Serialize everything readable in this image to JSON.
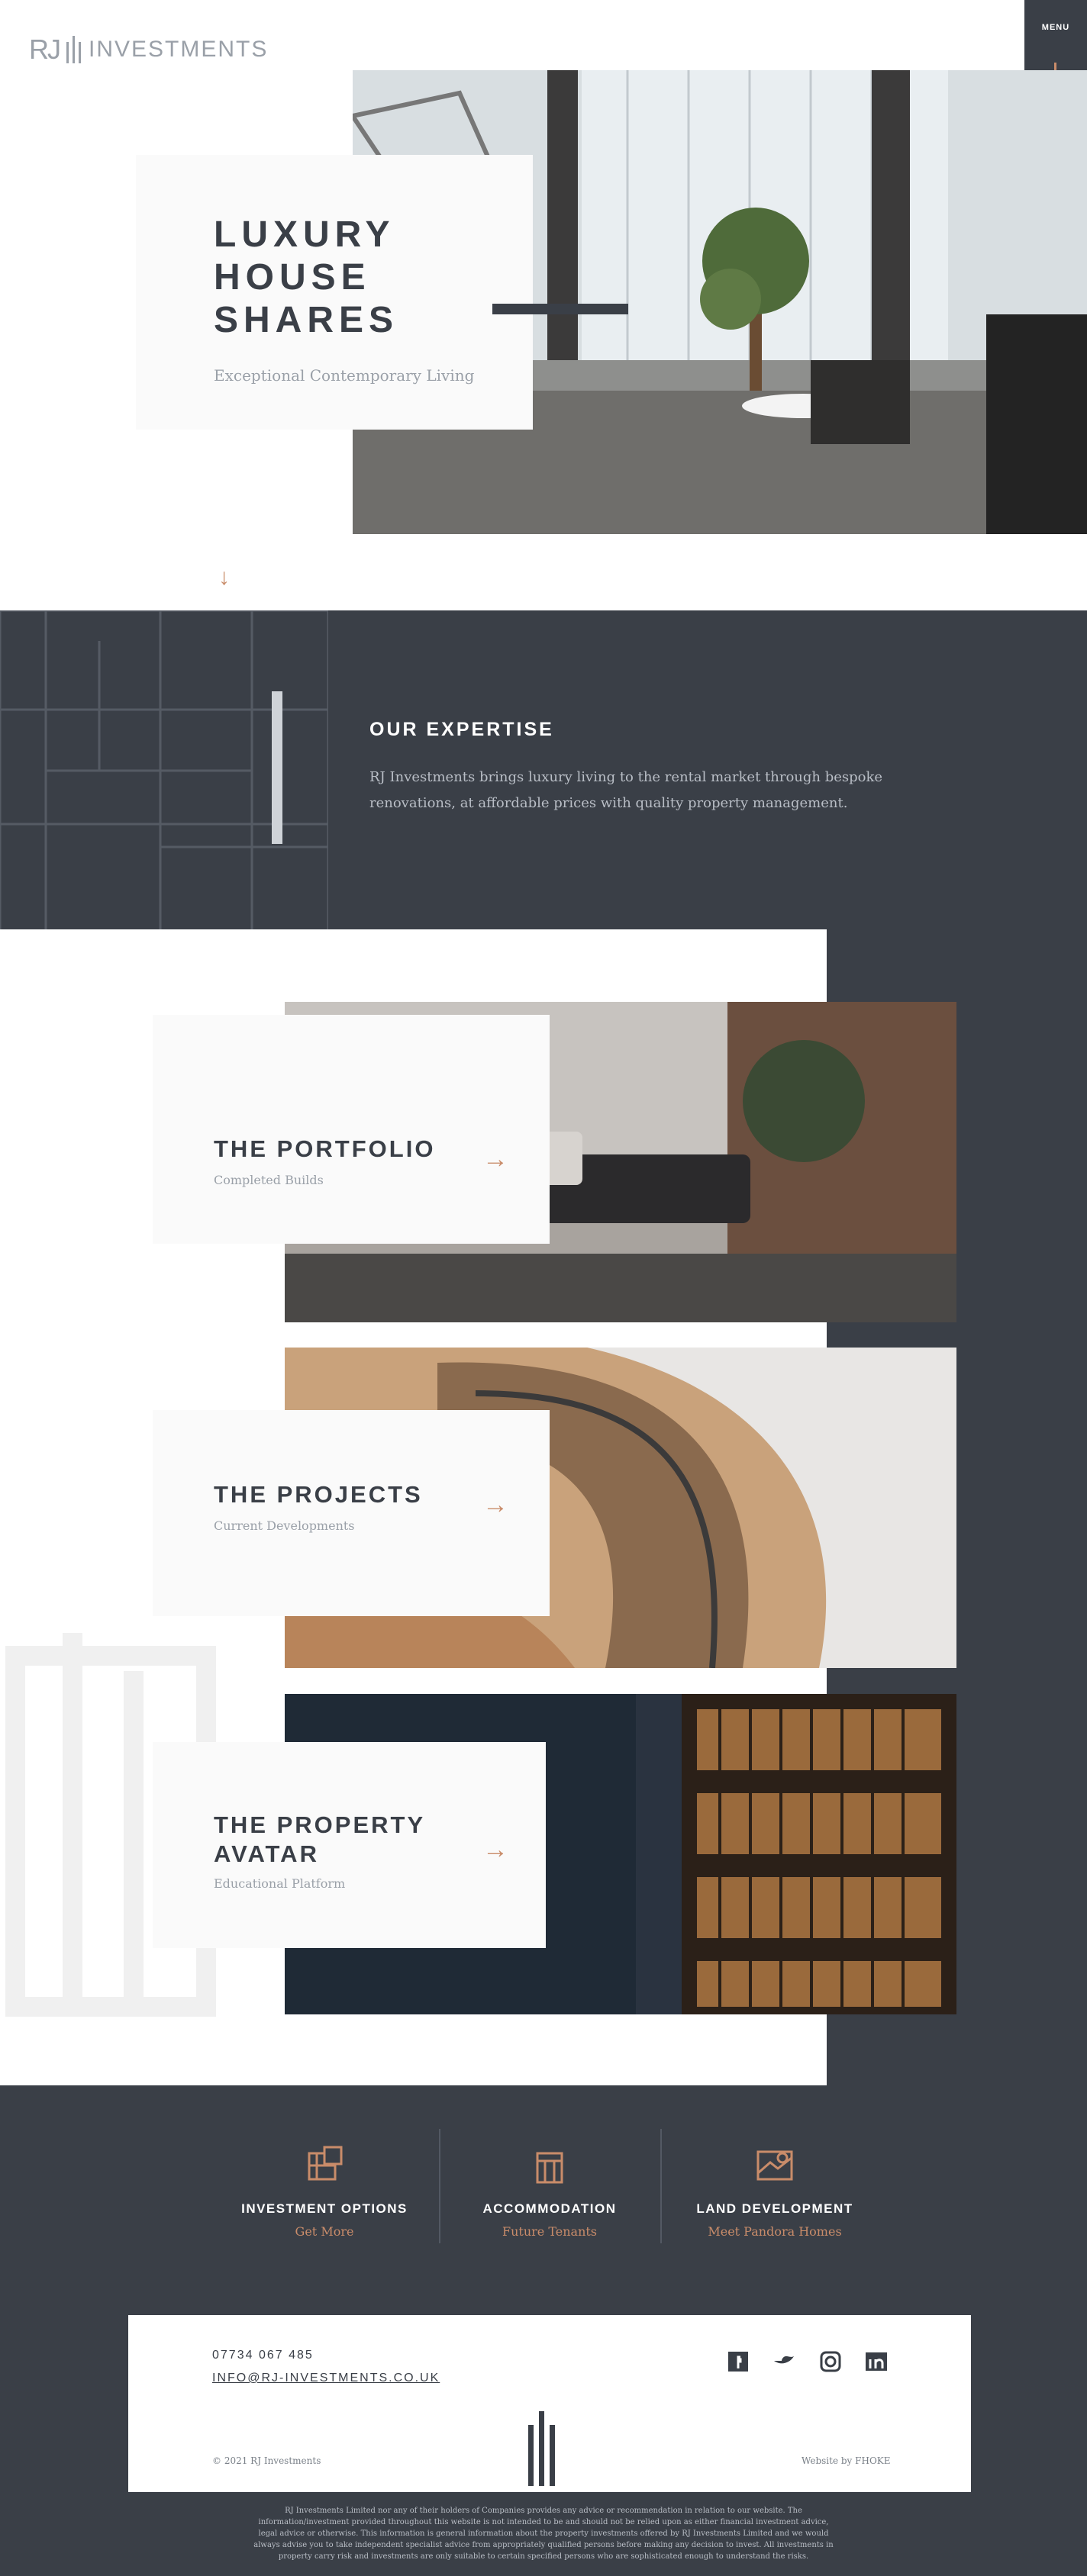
{
  "brand": {
    "logo_mark": "RJ",
    "logo_word": "INVESTMENTS"
  },
  "menu": {
    "label": "MENU",
    "icon": "building-bars-icon"
  },
  "hero": {
    "title_lines": [
      "LUXURY",
      "HOUSE",
      "SHARES"
    ],
    "subtitle": "Exceptional Contemporary Living",
    "scroll_icon": "down-arrow-icon"
  },
  "expertise": {
    "title": "OUR EXPERTISE",
    "body": "RJ Investments brings luxury living to the rental market through bespoke renovations, at affordable prices with quality property management."
  },
  "features": [
    {
      "title": "THE PORTFOLIO",
      "subtitle": "Completed Builds",
      "icon": "right-arrow-icon"
    },
    {
      "title": "THE PROJECTS",
      "subtitle": "Current Developments",
      "icon": "right-arrow-icon"
    },
    {
      "title_lines": [
        "THE PROPERTY",
        "AVATAR"
      ],
      "subtitle": "Educational Platform",
      "icon": "right-arrow-icon"
    }
  ],
  "services": [
    {
      "title": "INVESTMENT OPTIONS",
      "link": "Get More",
      "icon": "investment-icon"
    },
    {
      "title": "ACCOMMODATION",
      "link": "Future Tenants",
      "icon": "building-icon"
    },
    {
      "title": "LAND DEVELOPMENT",
      "link": "Meet Pandora Homes",
      "icon": "land-map-icon"
    }
  ],
  "footer": {
    "phone": "07734 067 485",
    "email": "INFO@RJ-INVESTMENTS.CO.UK",
    "social_icons": [
      "facebook-icon",
      "twitter-icon",
      "instagram-icon",
      "linkedin-icon"
    ],
    "copyright": "© 2021 RJ Investments",
    "credit": "Website by FHOKE",
    "disclaimer": "RJ Investments Limited nor any of their holders of Companies provides any advice or recommendation in relation to our website. The information/investment provided throughout this website is not intended to be and should not be relied upon as either financial investment advice, legal advice or otherwise. This information is general information about the property investments offered by RJ Investments Limited and we would always advise you to take independent specialist advice from appropriately qualified persons before making any decision to invest. All investments in property carry risk and investments are only suitable to certain specified persons who are sophisticated enough to understand the risks."
  },
  "colors": {
    "dark": "#3a3f47",
    "accent": "#c98c6a",
    "muted": "#9aa0a8",
    "light": "#fafafa"
  }
}
